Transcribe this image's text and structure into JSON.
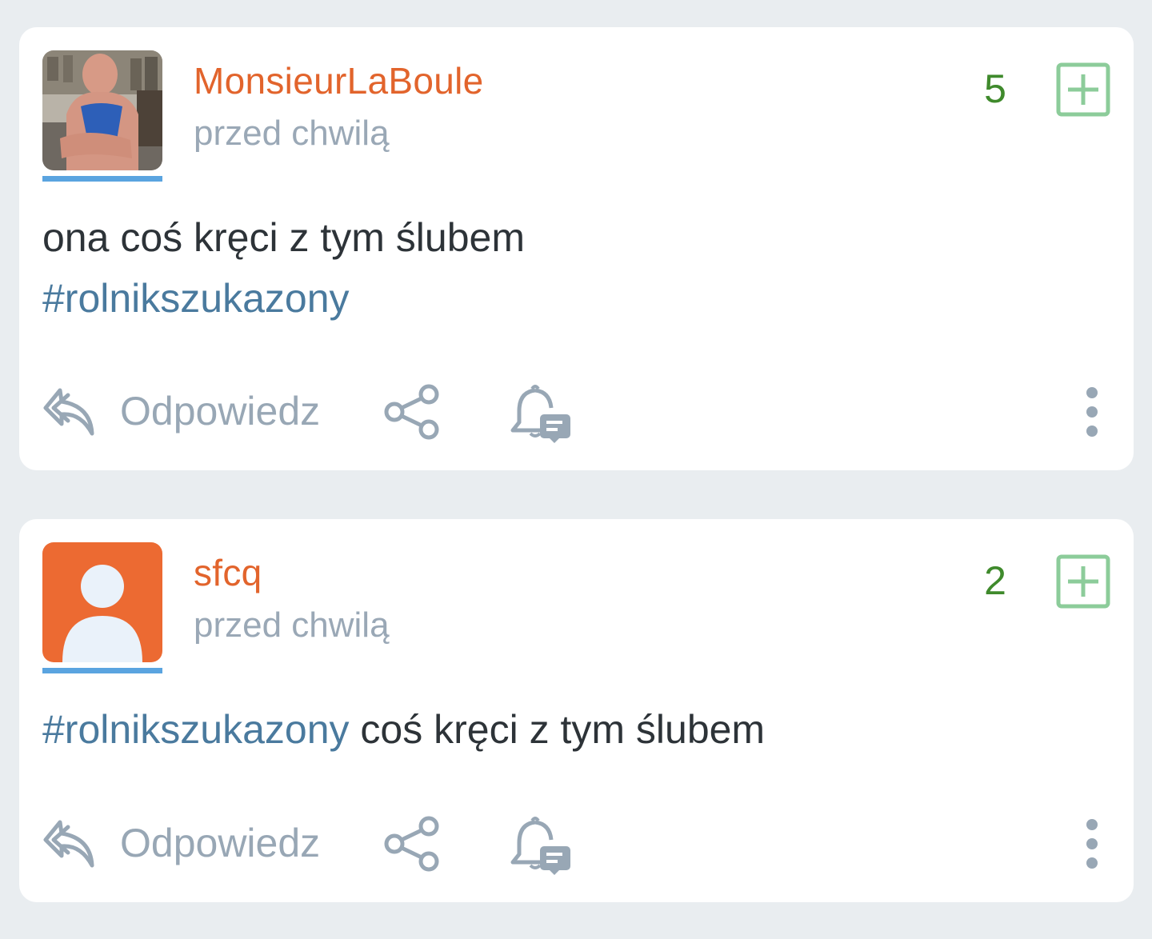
{
  "colors": {
    "accent_author": "#e2642c",
    "score": "#3f8a2c",
    "plus": "#8ccc9a",
    "tag": "#4a7a9e",
    "muted": "#98a7b5",
    "avatar_bar": "#5aa4e0"
  },
  "posts": [
    {
      "author": "MonsieurLaBoule",
      "time": "przed chwilą",
      "score": "5",
      "avatar_icon": "user-photo",
      "text": "ona coś kręci z tym ślubem",
      "hashtag": "#rolnikszukazony",
      "reply_label": "Odpowiedz"
    },
    {
      "author": "sfcq",
      "time": "przed chwilą",
      "score": "2",
      "avatar_icon": "default-user-avatar",
      "hashtag": "#rolnikszukazony",
      "text": " coś kręci z tym ślubem",
      "reply_label": "Odpowiedz"
    }
  ]
}
